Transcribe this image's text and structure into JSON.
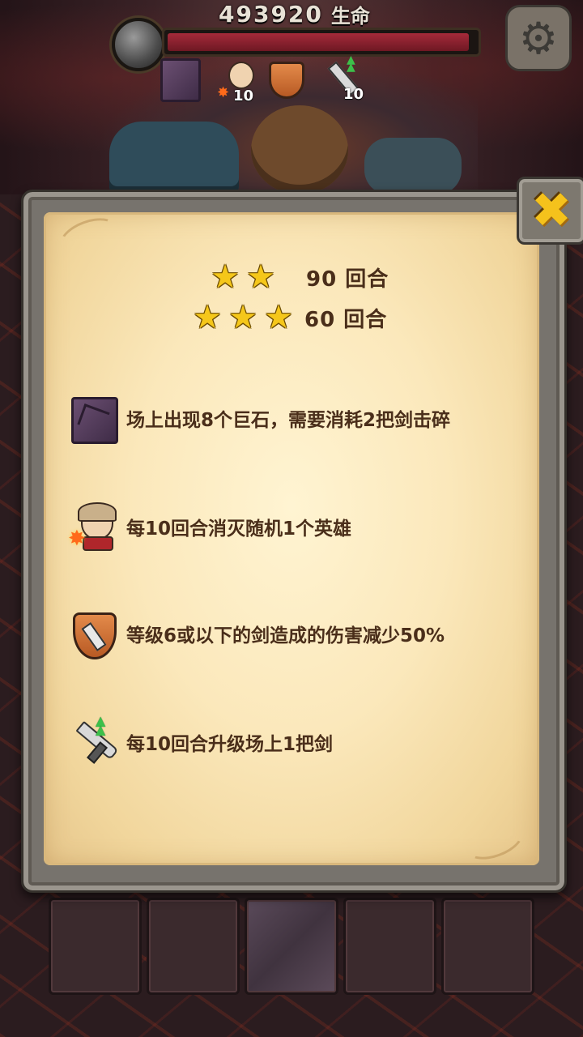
{
  "hud": {
    "hp_value": "493920",
    "hp_label": "生命",
    "hp_fraction": 0.98,
    "settings_icon": "gear-icon",
    "mini_icons": [
      {
        "icon": "boulder-icon"
      },
      {
        "icon": "hero-kill-icon",
        "count": "10"
      },
      {
        "icon": "shield-icon"
      },
      {
        "icon": "sword-upgrade-icon",
        "count": "10"
      }
    ]
  },
  "panel": {
    "close_icon": "close-icon",
    "star_rows": [
      {
        "stars": 2,
        "label": "90 回合"
      },
      {
        "stars": 3,
        "label": "60 回合"
      }
    ],
    "rules": [
      {
        "icon": "boulder-icon",
        "text": "场上出现8个巨石，需要消耗2把剑击碎"
      },
      {
        "icon": "hero-kill-icon",
        "text": "每10回合消灭随机1个英雄"
      },
      {
        "icon": "shield-icon",
        "text": "等级6或以下的剑造成的伤害减少50%"
      },
      {
        "icon": "sword-upgrade-icon",
        "text": "每10回合升级场上1把剑"
      }
    ]
  },
  "colors": {
    "star": "#f5c71a",
    "text": "#4a2e1a",
    "hp_bar": "#a52a3a",
    "close": "#f5c21c"
  }
}
